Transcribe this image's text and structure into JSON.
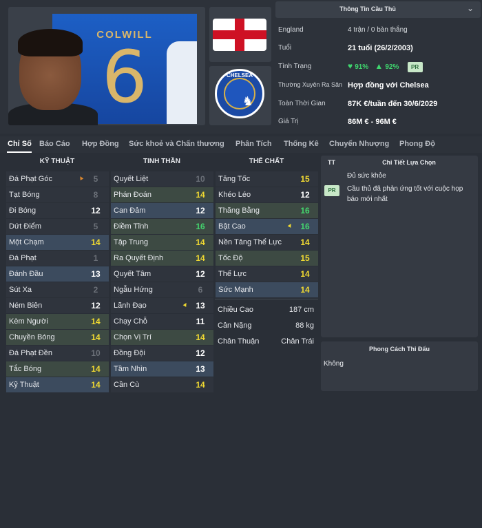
{
  "player": {
    "shirt_name": "COLWILL",
    "shirt_number": "6"
  },
  "club": {
    "crest_text": "CHELSEA",
    "crest_icon": "lion-icon"
  },
  "info": {
    "header": "Thông Tin Cầu Thủ",
    "rows": [
      {
        "label": "England",
        "value": "4 trận / 0 bàn thắng"
      },
      {
        "label": "Tuổi",
        "value": "21 tuổi (26/2/2003)"
      },
      {
        "label": "Tình Trạng",
        "heart_pct": "91%",
        "up_pct": "92%",
        "badge": "PR"
      },
      {
        "label": "Thường Xuyên Ra Sân",
        "value": "Hợp đồng với Chelsea"
      },
      {
        "label": "Toàn Thời Gian",
        "value": "87K  €/tuần đến 30/6/2029"
      },
      {
        "label": "Giá Trị",
        "value": "86M  € - 96M  €"
      }
    ]
  },
  "tabs": [
    "Chỉ Số",
    "Báo Cáo",
    "Hợp Đồng",
    "Sức khoẻ và Chấn thương",
    "Phân Tích",
    "Thống Kê",
    "Chuyển Nhượng",
    "Phong Độ"
  ],
  "columns": {
    "technical": {
      "title": "KỸ THUẬT",
      "items": [
        {
          "name": "Đá Phạt Góc",
          "value": "5",
          "color": "gray",
          "arrow": "up-orange"
        },
        {
          "name": "Tạt Bóng",
          "value": "8",
          "color": "gray"
        },
        {
          "name": "Đi Bóng",
          "value": "12",
          "color": "white"
        },
        {
          "name": "Dứt Điểm",
          "value": "5",
          "color": "gray"
        },
        {
          "name": "Một Chạm",
          "value": "14",
          "color": "yellow",
          "hl": "blue"
        },
        {
          "name": "Đá Phạt",
          "value": "1",
          "color": "gray"
        },
        {
          "name": "Đánh Đầu",
          "value": "13",
          "color": "white",
          "hl": "blue"
        },
        {
          "name": "Sút Xa",
          "value": "2",
          "color": "gray"
        },
        {
          "name": "Ném Biên",
          "value": "12",
          "color": "white"
        },
        {
          "name": "Kèm Người",
          "value": "14",
          "color": "yellow",
          "hl": "green"
        },
        {
          "name": "Chuyền Bóng",
          "value": "14",
          "color": "yellow",
          "hl": "green"
        },
        {
          "name": "Đá Phạt Đền",
          "value": "10",
          "color": "gray"
        },
        {
          "name": "Tắc Bóng",
          "value": "14",
          "color": "yellow",
          "hl": "green"
        },
        {
          "name": "Kỹ Thuật",
          "value": "14",
          "color": "yellow",
          "hl": "blue"
        }
      ]
    },
    "mental": {
      "title": "TINH THẦN",
      "items": [
        {
          "name": "Quyết Liệt",
          "value": "10",
          "color": "gray"
        },
        {
          "name": "Phán Đoán",
          "value": "14",
          "color": "yellow",
          "hl": "green"
        },
        {
          "name": "Can Đảm",
          "value": "12",
          "color": "white",
          "hl": "blue"
        },
        {
          "name": "Điềm Tĩnh",
          "value": "16",
          "color": "green",
          "hl": "green"
        },
        {
          "name": "Tập Trung",
          "value": "14",
          "color": "yellow",
          "hl": "green"
        },
        {
          "name": "Ra Quyết Định",
          "value": "14",
          "color": "yellow",
          "hl": "green"
        },
        {
          "name": "Quyết Tâm",
          "value": "12",
          "color": "white"
        },
        {
          "name": "Ngẫu Hứng",
          "value": "6",
          "color": "gray"
        },
        {
          "name": "Lãnh Đạo",
          "value": "13",
          "color": "white",
          "arrow": "up-yellow"
        },
        {
          "name": "Chạy Chỗ",
          "value": "11",
          "color": "white"
        },
        {
          "name": "Chọn Vị Trí",
          "value": "14",
          "color": "yellow",
          "hl": "green"
        },
        {
          "name": "Đồng Đội",
          "value": "12",
          "color": "white"
        },
        {
          "name": "Tầm Nhìn",
          "value": "13",
          "color": "white",
          "hl": "blue"
        },
        {
          "name": "Cần Cù",
          "value": "14",
          "color": "yellow"
        }
      ]
    },
    "physical": {
      "title": "THỂ CHẤT",
      "items": [
        {
          "name": "Tăng Tốc",
          "value": "15",
          "color": "yellow"
        },
        {
          "name": "Khéo Léo",
          "value": "12",
          "color": "white"
        },
        {
          "name": "Thăng Bằng",
          "value": "16",
          "color": "green",
          "hl": "green"
        },
        {
          "name": "Bật Cao",
          "value": "16",
          "color": "green",
          "hl": "blue",
          "arrow": "up-yellow"
        },
        {
          "name": "Nền Tảng Thể Lực",
          "value": "14",
          "color": "yellow"
        },
        {
          "name": "Tốc Độ",
          "value": "15",
          "color": "yellow",
          "hl": "green"
        },
        {
          "name": "Thể Lực",
          "value": "14",
          "color": "yellow"
        },
        {
          "name": "Sức Mạnh",
          "value": "14",
          "color": "yellow",
          "hl": "blue"
        }
      ],
      "details": [
        {
          "label": "Chiều Cao",
          "value": "187 cm"
        },
        {
          "label": "Cân Nặng",
          "value": "88 kg"
        },
        {
          "label": "Chân Thuận",
          "value": "Chân Trái"
        }
      ]
    }
  },
  "selection_panel": {
    "col_a": "TT",
    "title": "Chi Tiết Lựa Chọn",
    "line1": "Đủ sức khỏe",
    "badge": "PR",
    "line2": "Cầu thủ đã phản ứng tốt với cuộc họp báo mới nhất"
  },
  "style_panel": {
    "title": "Phong Cách Thi Đấu",
    "value": "Không"
  }
}
